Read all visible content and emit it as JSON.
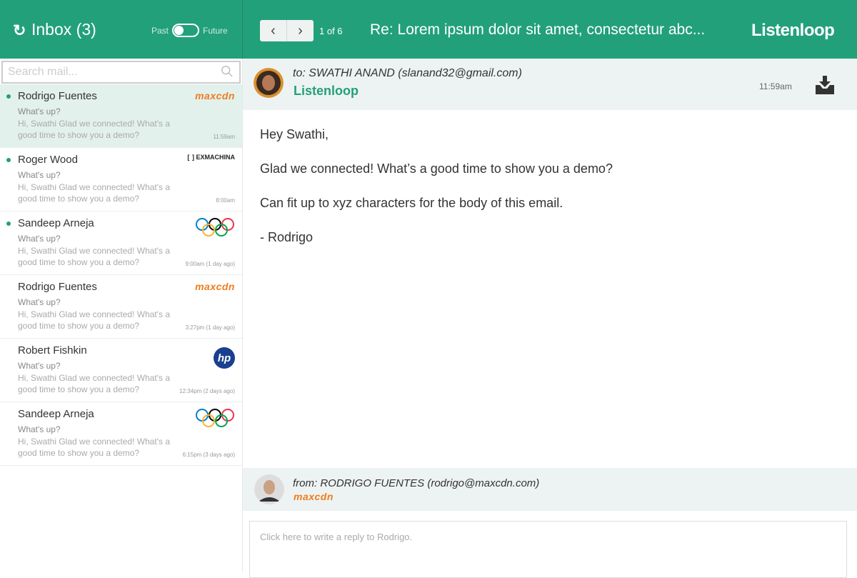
{
  "header": {
    "inbox_title": "Inbox (3)",
    "past_label": "Past",
    "future_label": "Future",
    "toggle_on": true,
    "pager": "1 of 6",
    "subject": "Re: Lorem ipsum dolor sit amet, consectetur abc...",
    "brand": "Listenloop",
    "prev_icon": "chevron-left",
    "next_icon": "chevron-right"
  },
  "search": {
    "placeholder": "Search mail..."
  },
  "messages": [
    {
      "name": "Rodrigo Fuentes",
      "subject": "What's up?",
      "preview": "Hi, Swathi Glad we connected! What's a good time to show you a demo?",
      "time": "11:59am",
      "unread": true,
      "logo": "maxcdn"
    },
    {
      "name": "Roger Wood",
      "subject": "What's up?",
      "preview": "Hi, Swathi Glad we connected! What's a good time to show you a demo?",
      "time": "8:00am",
      "unread": true,
      "logo": "EXMACHINA"
    },
    {
      "name": "Sandeep Arneja",
      "subject": "What's up?",
      "preview": "Hi, Swathi Glad we connected! What's a good time to show you a demo?",
      "time": "9:00am (1 day ago)",
      "unread": true,
      "logo": "olympics"
    },
    {
      "name": "Rodrigo Fuentes",
      "subject": "What's up?",
      "preview": "Hi, Swathi Glad we connected! What's a good time to show you a demo?",
      "time": "3:27pm (1 day ago)",
      "unread": false,
      "logo": "maxcdn"
    },
    {
      "name": "Robert Fishkin",
      "subject": "What's up?",
      "preview": "Hi, Swathi Glad we connected! What's a good time to show you a demo?",
      "time": "12:34pm (2 days ago)",
      "unread": false,
      "logo": "hp"
    },
    {
      "name": "Sandeep Arneja",
      "subject": "What's up?",
      "preview": "Hi, Swathi Glad we connected! What's a good time to show you a demo?",
      "time": "6:15pm (3 days ago)",
      "unread": false,
      "logo": "olympics"
    }
  ],
  "email": {
    "to": "to: SWATHI ANAND (slanand32@gmail.com)",
    "to_company": "Listenloop",
    "time": "11:59am",
    "body": [
      "Hey Swathi,",
      "Glad we connected! What’s a good time to show you a demo?",
      "Can fit up to xyz characters for the body of this email.",
      "- Rodrigo"
    ],
    "from": "from: RODRIGO FUENTES (rodrigo@maxcdn.com)",
    "from_company": "maxcdn"
  },
  "reply": {
    "placeholder": "Click here to write a reply to Rodrigo."
  },
  "colors": {
    "accent": "#22a07a",
    "maxcdn": "#f07c1e"
  }
}
